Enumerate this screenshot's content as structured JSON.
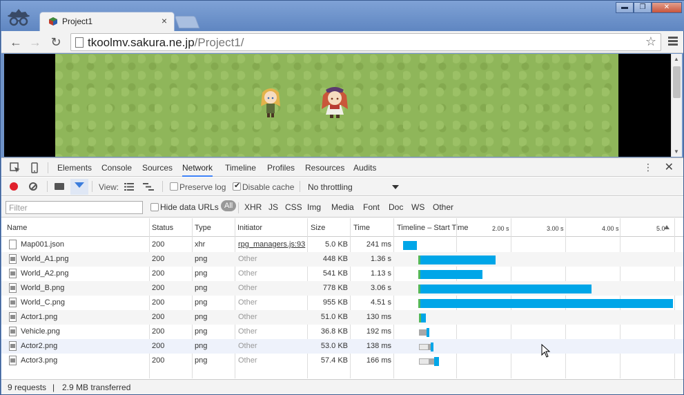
{
  "browser": {
    "tab_title": "Project1",
    "tab_close": "×",
    "url_host": "tkoolmv.sakura.ne.jp",
    "url_path": "/Project1/",
    "window_buttons": [
      "▬",
      "❐",
      "✕"
    ]
  },
  "devtools": {
    "tabs": [
      "Elements",
      "Console",
      "Sources",
      "Network",
      "Timeline",
      "Profiles",
      "Resources",
      "Audits"
    ],
    "active_tab": "Network",
    "network_toolbar": {
      "view_label": "View:",
      "preserve_log": "Preserve log",
      "preserve_log_checked": false,
      "disable_cache": "Disable cache",
      "disable_cache_checked": true,
      "throttling": "No throttling"
    },
    "filter": {
      "placeholder": "Filter",
      "hide_data_urls": "Hide data URLs",
      "types": [
        "All",
        "XHR",
        "JS",
        "CSS",
        "Img",
        "Media",
        "Font",
        "Doc",
        "WS",
        "Other"
      ],
      "active_type": "All"
    },
    "columns": [
      "Name",
      "Status",
      "Type",
      "Initiator",
      "Size",
      "Time",
      "Timeline – Start Time"
    ],
    "timeline_ticks": [
      "2.00 s",
      "3.00 s",
      "4.00 s",
      "5.0"
    ],
    "rows": [
      {
        "name": "Map001.json",
        "status": "200",
        "type": "xhr",
        "initiator": "rpg_managers.js:93",
        "size": "5.0 KB",
        "time": "241 ms",
        "icon": "json"
      },
      {
        "name": "World_A1.png",
        "status": "200",
        "type": "png",
        "initiator": "Other",
        "size": "448 KB",
        "time": "1.36 s",
        "icon": "img"
      },
      {
        "name": "World_A2.png",
        "status": "200",
        "type": "png",
        "initiator": "Other",
        "size": "541 KB",
        "time": "1.13 s",
        "icon": "img"
      },
      {
        "name": "World_B.png",
        "status": "200",
        "type": "png",
        "initiator": "Other",
        "size": "778 KB",
        "time": "3.06 s",
        "icon": "img"
      },
      {
        "name": "World_C.png",
        "status": "200",
        "type": "png",
        "initiator": "Other",
        "size": "955 KB",
        "time": "4.51 s",
        "icon": "img"
      },
      {
        "name": "Actor1.png",
        "status": "200",
        "type": "png",
        "initiator": "Other",
        "size": "51.0 KB",
        "time": "130 ms",
        "icon": "img"
      },
      {
        "name": "Vehicle.png",
        "status": "200",
        "type": "png",
        "initiator": "Other",
        "size": "36.8 KB",
        "time": "192 ms",
        "icon": "img"
      },
      {
        "name": "Actor2.png",
        "status": "200",
        "type": "png",
        "initiator": "Other",
        "size": "53.0 KB",
        "time": "138 ms",
        "icon": "img"
      },
      {
        "name": "Actor3.png",
        "status": "200",
        "type": "png",
        "initiator": "Other",
        "size": "57.4 KB",
        "time": "166 ms",
        "icon": "img"
      }
    ],
    "status_requests": "9 requests",
    "status_separator": "|",
    "status_transferred": "2.9 MB transferred"
  },
  "colors": {
    "accent": "#3e82f7",
    "download_bar": "#00a6e8",
    "record": "#e0202b",
    "grass": "#8fb65a"
  }
}
